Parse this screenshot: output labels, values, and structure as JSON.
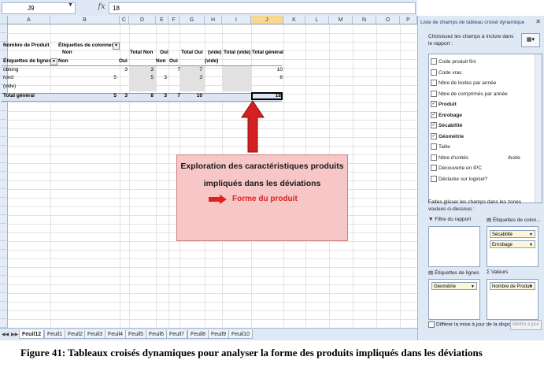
{
  "formula_bar": {
    "name_box": "J9",
    "fx": "fx",
    "formula": "18"
  },
  "columns": [
    "A",
    "B",
    "C",
    "D",
    "E",
    "F",
    "G",
    "H",
    "I",
    "J",
    "K",
    "L",
    "M",
    "N",
    "O",
    "P"
  ],
  "rows": [
    "1",
    "2",
    "3",
    "4",
    "5",
    "6",
    "7",
    "8",
    "9",
    "10",
    "11",
    "12",
    "13",
    "14",
    "15",
    "16",
    "17",
    "18",
    "19",
    "20",
    "21",
    "22",
    "23",
    "24",
    "25",
    "26",
    "27",
    "28",
    "29",
    "30",
    "31",
    "32",
    "33",
    "34",
    "35",
    "36"
  ],
  "pivot": {
    "product_name": "Nombre de Produit",
    "col_labels": "Étiquettes de colonnes",
    "non1": "Non",
    "oui1": "Oui",
    "total_non": "Total Non",
    "oui2": "Oui",
    "total_oui": "Total Oui",
    "vide1": "(vide)",
    "total_vide": "Total (vide)",
    "grand_total": "Total général",
    "row_labels": "Étiquettes de lignes",
    "non2": "Non",
    "oui3": "Oui",
    "non3": "Non",
    "oui4": "Oui",
    "vide2": "(vide)",
    "rows": [
      {
        "label": "oblong",
        "c": "3",
        "d": "3",
        "f": "7",
        "g": "7",
        "j": "10"
      },
      {
        "label": "rond",
        "b": "5",
        "d": "5",
        "e": "3",
        "g": "3",
        "j": "8"
      },
      {
        "label": "(vide)"
      }
    ],
    "total": {
      "label": "Total général",
      "b": "5",
      "c": "3",
      "d": "8",
      "e": "3",
      "f": "7",
      "g": "10",
      "j": "18"
    }
  },
  "callout": {
    "line1": "Exploration des caractéristiques produits",
    "line2": "impliqués dans les déviations",
    "line3": "Forme du produit",
    "color": "#f7c6c6",
    "arrow_color": "#d42020"
  },
  "tabs": [
    "Feuil12",
    "Feuil1",
    "Feuil2",
    "Feuil3",
    "Feuil4",
    "Feuil5",
    "Feuil6",
    "Feuil7",
    "Feuil8",
    "Feuil9",
    "Feuil10"
  ],
  "panel": {
    "title": "Liste de champs de tableau croisé dynamique",
    "desc": "Choisissez les champs à inclure dans le rapport :",
    "fields": [
      {
        "label": "Code produit fini",
        "checked": false
      },
      {
        "label": "Code vrac",
        "checked": false
      },
      {
        "label": "Nbre de boites par année",
        "checked": false
      },
      {
        "label": "Nbre de comprimés par année",
        "checked": false
      },
      {
        "label": "Produit",
        "checked": true
      },
      {
        "label": "Enrobage",
        "checked": true
      },
      {
        "label": "Sécabilité",
        "checked": true
      },
      {
        "label": "Géométrie",
        "checked": true
      },
      {
        "label": "Taille",
        "checked": false
      },
      {
        "label": "Nbre d'unités",
        "extra": "/boite",
        "checked": false
      },
      {
        "label": "Découverte en IPC",
        "checked": false
      },
      {
        "label": "Déclarée sur logiciel?",
        "checked": false
      }
    ],
    "drag": "Faites glisser les champs dans les zones voulues ci-dessous :",
    "report_filter": "Filtre du rapport",
    "col_labels": "Étiquettes de colon...",
    "row_labels": "Étiquettes de lignes",
    "values": "Valeurs",
    "col_items": [
      "Sécabilité",
      "Enrobage"
    ],
    "row_items": [
      "Géométrie"
    ],
    "value_items": [
      "Nombre de Produit"
    ],
    "defer": "Différer la mise à jour de la dispo...",
    "update": "Mettre à jour"
  },
  "caption": "Figure 41: Tableaux croisés dynamiques pour analyser la forme des produits impliqués dans les déviations"
}
